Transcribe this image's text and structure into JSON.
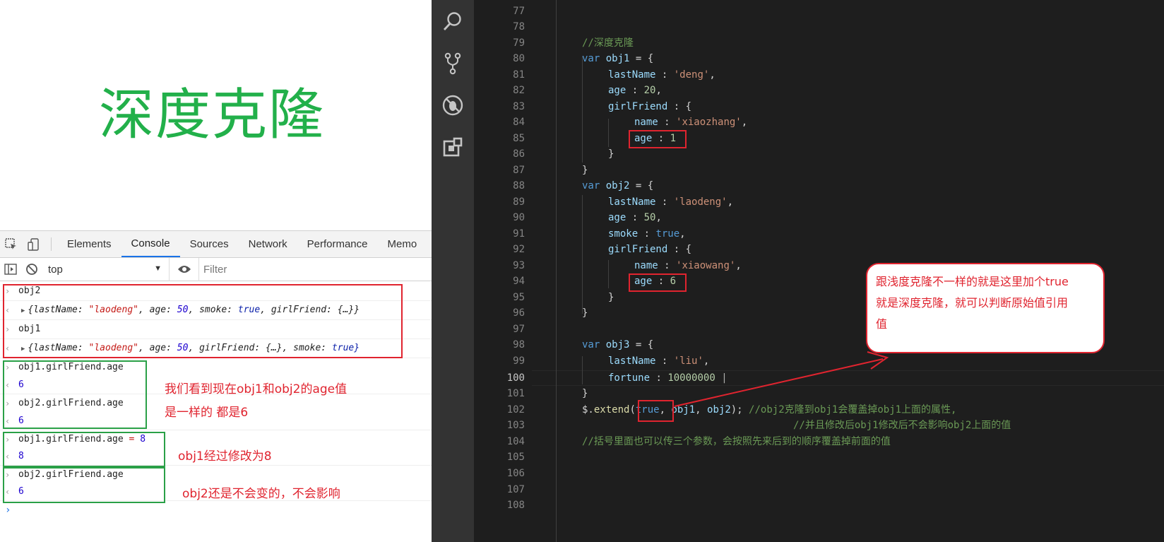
{
  "page": {
    "heading": "深度克隆"
  },
  "devtools": {
    "tabs": [
      "Elements",
      "Console",
      "Sources",
      "Network",
      "Performance",
      "Memo"
    ],
    "active_tab": "Console",
    "context": "top",
    "filter_placeholder": "Filter"
  },
  "console": {
    "in1": "obj2",
    "out1": {
      "lastName_key": "lastName: ",
      "lastName_val": "\"laodeng\"",
      "age_key": ", age: ",
      "age_val": "50",
      "smoke_key": ", smoke: ",
      "smoke_val": "true",
      "gf_key": ", girlFriend: ",
      "gf_val": "{…}}"
    },
    "in2": "obj1",
    "out2": {
      "lastName_key": "lastName: ",
      "lastName_val": "\"laodeng\"",
      "age_key": ", age: ",
      "age_val": "50",
      "gf_key": ", girlFriend: ",
      "gf_val": "{…}",
      "smoke_key": ", smoke: ",
      "smoke_val": "true}"
    },
    "in3": "obj1.girlFriend.age",
    "out3": "6",
    "in4": "obj2.girlFriend.age",
    "out4": "6",
    "in5a": "obj1.girlFriend.age",
    "in5b": " = ",
    "in5c": "8",
    "out5": "8",
    "in6": "obj2.girlFriend.age",
    "out6": "6"
  },
  "annotations": {
    "a1_line1": "我们看到现在obj1和obj2的age值",
    "a1_line2": "是一样的  都是6",
    "a2": "obj1经过修改为8",
    "a3": "obj2还是不会变的，不会影响",
    "callout_line1": "跟浅度克隆不一样的就是这里加个true",
    "callout_line2": "就是深度克隆，就可以判断原始值引用",
    "callout_line3": "值"
  },
  "editor": {
    "line_numbers": [
      "77",
      "78",
      "79",
      "80",
      "81",
      "82",
      "83",
      "84",
      "85",
      "86",
      "87",
      "88",
      "89",
      "90",
      "91",
      "92",
      "93",
      "94",
      "95",
      "96",
      "97",
      "98",
      "99",
      "100",
      "101",
      "102",
      "103",
      "104",
      "105",
      "106",
      "107",
      "108"
    ],
    "current_line": "100",
    "code": {
      "c79": "//深度克隆",
      "var": "var",
      "obj1": "obj1",
      "obj2": "obj2",
      "obj3": "obj3",
      "eq_brace": " = {",
      "lastName": "lastName",
      "age": "age",
      "girlFriend": "girlFriend",
      "name": "name",
      "smoke": "smoke",
      "fortune": "fortune",
      "colon": " : ",
      "comma": ",",
      "open": "{",
      "close": "}",
      "deng": "'deng'",
      "laodeng": "'laodeng'",
      "xiaozhang": "'xiaozhang'",
      "xiaowang": "'xiaowang'",
      "liu": "'liu'",
      "n20": "20",
      "n1": "1",
      "n50": "50",
      "n6": "6",
      "n10000000": "10000000",
      "true": "true",
      "dollar": "$.",
      "extend": "extend",
      "args_open": "(",
      "args_rest_a": ", ",
      "args_rest_b": ", ",
      "args_close": ");",
      "c102": "//obj2克隆到obj1会覆盖掉obj1上面的属性,",
      "c103": "//并且修改后obj1修改后不会影响obj2上面的值",
      "c104": "//括号里面也可以传三个参数，会按照先来后到的顺序覆盖掉前面的值"
    }
  },
  "colors": {
    "heading": "#22b04a",
    "annotation": "#e0242f",
    "green_box": "#2aa047",
    "editor_bg": "#1e1e1e",
    "activity_bg": "#333333"
  },
  "icons": [
    "inspect-icon",
    "device-toggle-icon",
    "sidebar-toggle-icon",
    "clear-console-icon",
    "eye-icon",
    "search-icon",
    "source-control-icon",
    "no-debug-icon",
    "extensions-icon"
  ]
}
